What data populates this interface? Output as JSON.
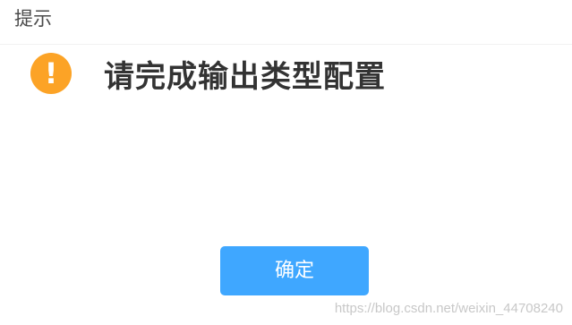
{
  "dialog": {
    "title": "提示",
    "message": "请完成输出类型配置",
    "icon": "warning-icon",
    "icon_color": "#fca326",
    "confirm_label": "确定",
    "confirm_color": "#3fa7ff"
  },
  "watermark": "https://blog.csdn.net/weixin_44708240"
}
